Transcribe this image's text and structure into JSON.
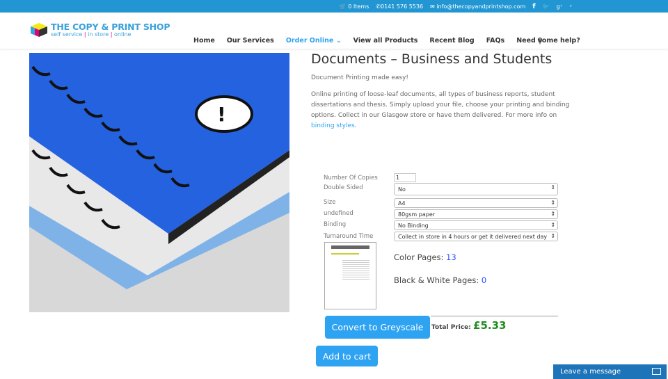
{
  "topbar": {
    "cart": "0 Items",
    "phone": "0141 576 5536",
    "email": "info@thecopyandprintshop.com"
  },
  "logo": {
    "title": "THE COPY & PRINT SHOP",
    "sub1": "self service",
    "sub2": "in store",
    "sub3": "online"
  },
  "nav": [
    "Home",
    "Our Services",
    "Order Online",
    "View all Products",
    "Recent Blog",
    "FAQs",
    "Need some help?"
  ],
  "product": {
    "title": "Documents – Business and Students",
    "subtitle": "Document Printing made easy!",
    "desc": "Online printing of loose-leaf documents, all types of business reports, student dissertations and thesis. Simply upload your file, choose your printing and binding options. Collect in our Glasgow store or have them delivered. For more info on ",
    "link": "binding styles",
    "desc_end": "."
  },
  "form": {
    "copies_label": "Number Of Copies",
    "copies": "1",
    "double_label": "Double Sided",
    "double": "No",
    "size_label": "Size",
    "size": "A4",
    "paper_label": "undefined",
    "paper": "80gsm paper",
    "binding_label": "Binding",
    "binding": "No Binding",
    "turn_label": "Turnaround Time",
    "turn": "Collect in store in 4 hours or get it delivered next day"
  },
  "pages": {
    "color_label": "Color Pages: ",
    "color": "13",
    "bw_label": "Black & White Pages: ",
    "bw": "0"
  },
  "greyscale": "Convert to Greyscale",
  "total": {
    "label": "Total Price: ",
    "value": "£5.33"
  },
  "cart": "Add to cart",
  "chat": "Leave a message"
}
